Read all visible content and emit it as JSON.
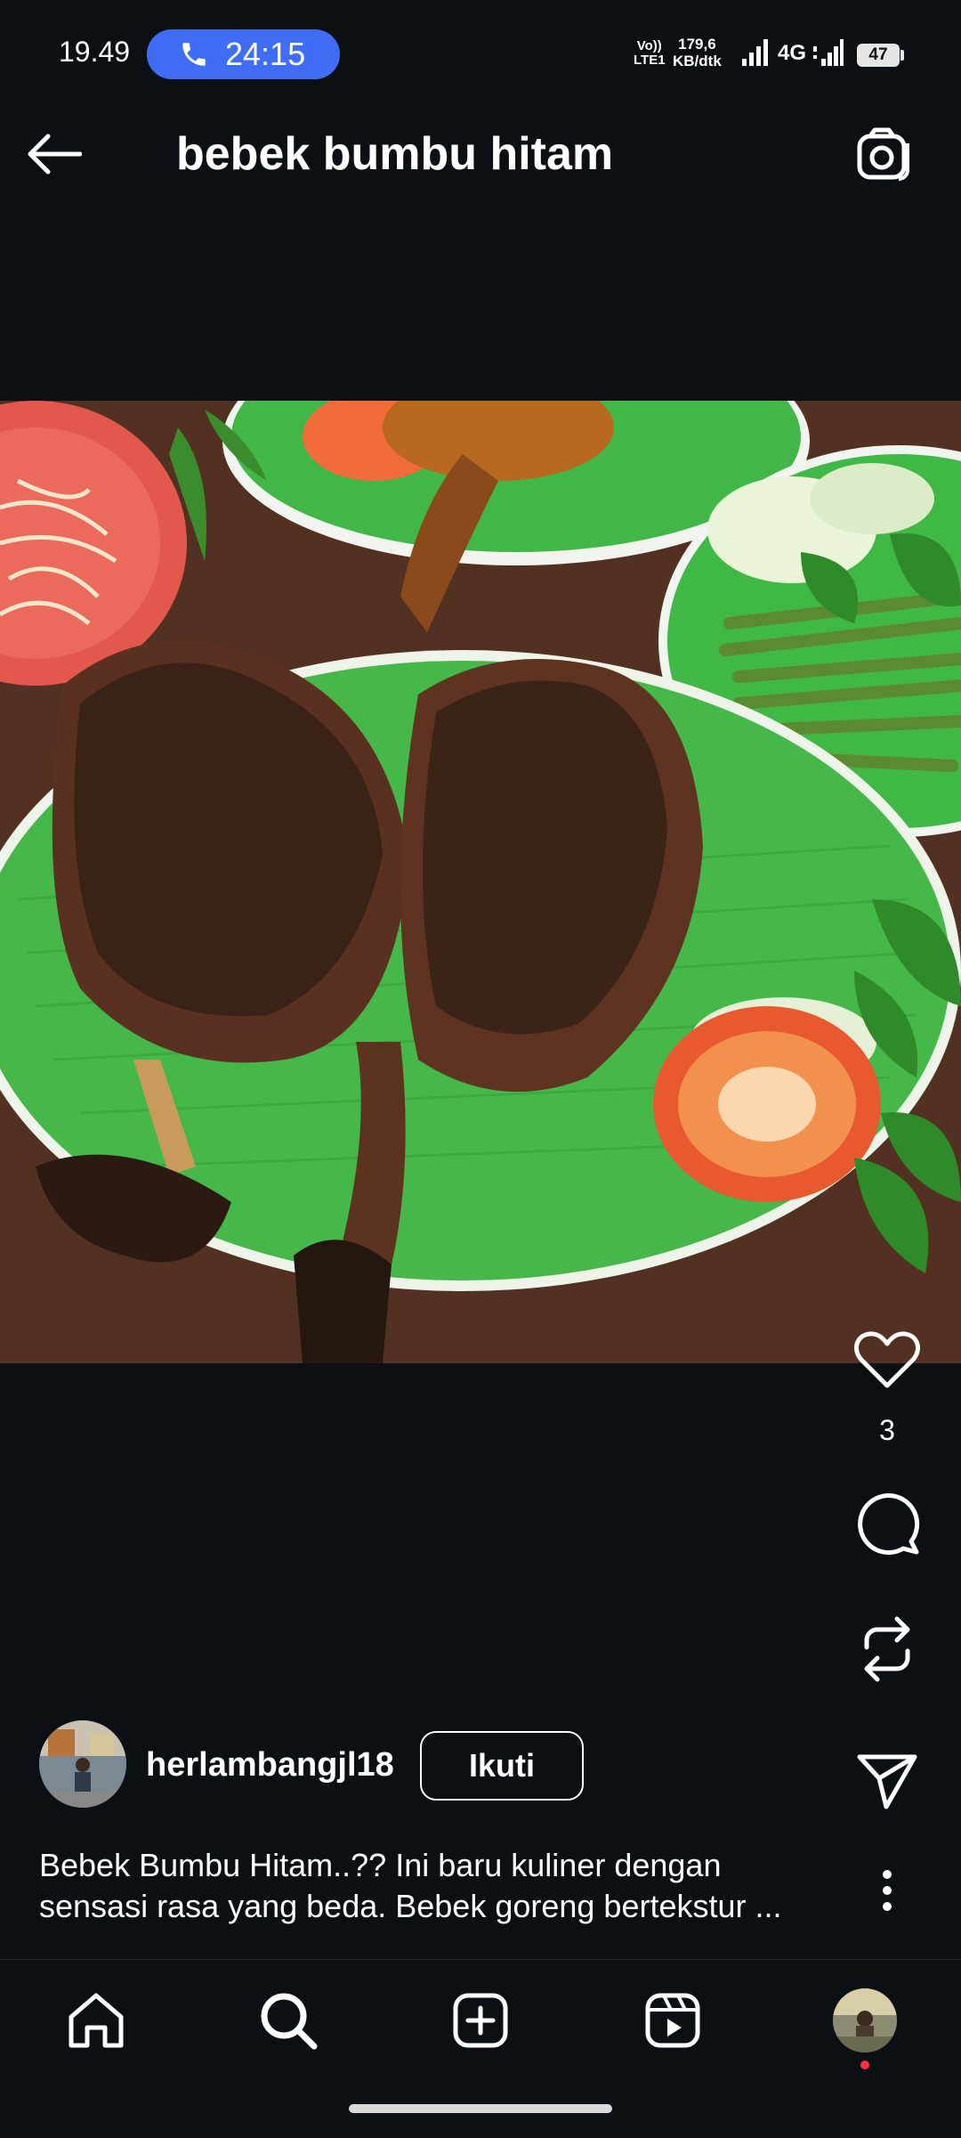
{
  "status_bar": {
    "time": "19.49",
    "call_duration": "24:15",
    "volte_line1": "Vo))",
    "volte_line2": "LTE1",
    "net_speed_value": "179,6",
    "net_speed_unit": "KB/dtk",
    "network_type": "4G",
    "battery_level": "47"
  },
  "header": {
    "title": "bebek bumbu hitam",
    "back_icon": "arrow-left-icon",
    "camera_icon": "camera-icon"
  },
  "post": {
    "image_subject": "duck-with-black-spice-dish-photo",
    "like_count": "3",
    "actions": [
      "heart-icon",
      "comment-icon",
      "repost-icon",
      "send-icon",
      "more-vertical-icon"
    ],
    "author": {
      "username": "herlambangjl18",
      "follow_label": "Ikuti"
    },
    "caption_line1": "Bebek Bumbu Hitam..?? Ini baru kuliner dengan",
    "caption_line2": "sensasi rasa yang beda. Bebek goreng bertekstur ..."
  },
  "bottom_nav": {
    "items": [
      "home-icon",
      "search-icon",
      "create-icon",
      "reels-icon",
      "profile-avatar"
    ]
  },
  "colors": {
    "background": "#0c1014",
    "call_pill": "#3f6df5",
    "plate_green": "#3fb845",
    "notification_dot": "#ff3040"
  }
}
